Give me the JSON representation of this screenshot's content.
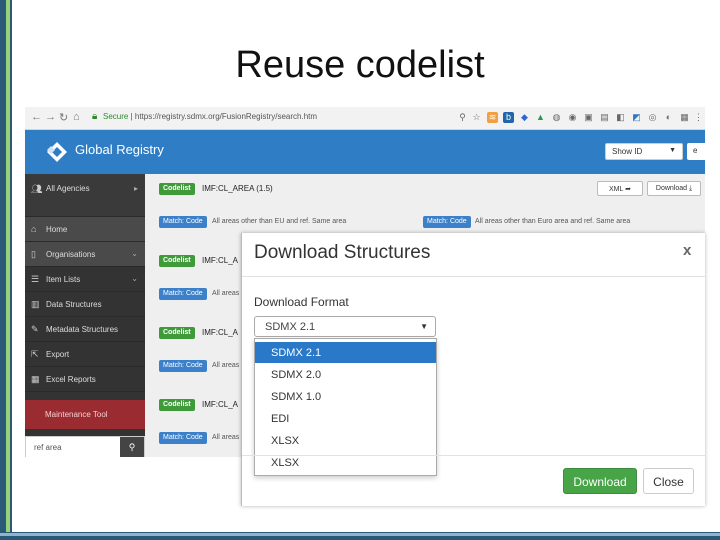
{
  "slide": {
    "title": "Reuse codelist"
  },
  "browser": {
    "lock_label": "Secure",
    "url_host": "https://registry.sdmx.org",
    "url_path": "/FusionRegistry/search.htm"
  },
  "app": {
    "name": "Global Registry",
    "show_id_label": "Show ID",
    "user_label": "e"
  },
  "sidebar": {
    "items": [
      {
        "label": "All Agencies",
        "icon": "users-icon"
      },
      {
        "label": "Home",
        "icon": "home-icon"
      },
      {
        "label": "Organisations",
        "icon": "building-icon"
      },
      {
        "label": "Item Lists",
        "icon": "list-icon"
      },
      {
        "label": "Data Structures",
        "icon": "bar-chart-icon"
      },
      {
        "label": "Metadata Structures",
        "icon": "pencil-icon"
      },
      {
        "label": "Export",
        "icon": "export-icon"
      },
      {
        "label": "Excel Reports",
        "icon": "excel-icon"
      }
    ],
    "maintenance_label": "Maintenance Tool",
    "search_value": "ref area"
  },
  "results": [
    {
      "type": "Codelist",
      "title": "IMF:CL_AREA",
      "version": "(1.5)",
      "match": "Match: Code",
      "desc": "All areas other than EU and ref. Same area",
      "match2": "Match: Code",
      "desc2": "All areas other than Euro area and ref. Same area"
    },
    {
      "type": "Codelist",
      "title": "IMF:CL_A",
      "match": "Match: Code",
      "desc": "All areas"
    },
    {
      "type": "Codelist",
      "title": "IMF:CL_A",
      "match": "Match: Code",
      "desc": "All areas"
    },
    {
      "type": "Codelist",
      "title": "IMF:CL_A",
      "match": "Match: Code",
      "desc": "All areas"
    }
  ],
  "row_buttons": {
    "xml": "XML",
    "download": "Download"
  },
  "modal": {
    "title": "Download Structures",
    "close_glyph": "x",
    "format_label": "Download Format",
    "selected": "SDMX 2.1",
    "options": [
      "SDMX 2.1",
      "SDMX 2.0",
      "SDMX 1.0",
      "EDI",
      "XLSX",
      "XLSX"
    ],
    "download_button": "Download",
    "close_button": "Close"
  },
  "colors": {
    "app_bar": "#2f7dc4",
    "sidebar": "#333333",
    "maintenance": "#9a2b31",
    "codelist_badge": "#3f9b3a",
    "match_badge": "#3b80c8",
    "option_selected": "#2a79c9",
    "download_button": "#47a447"
  }
}
